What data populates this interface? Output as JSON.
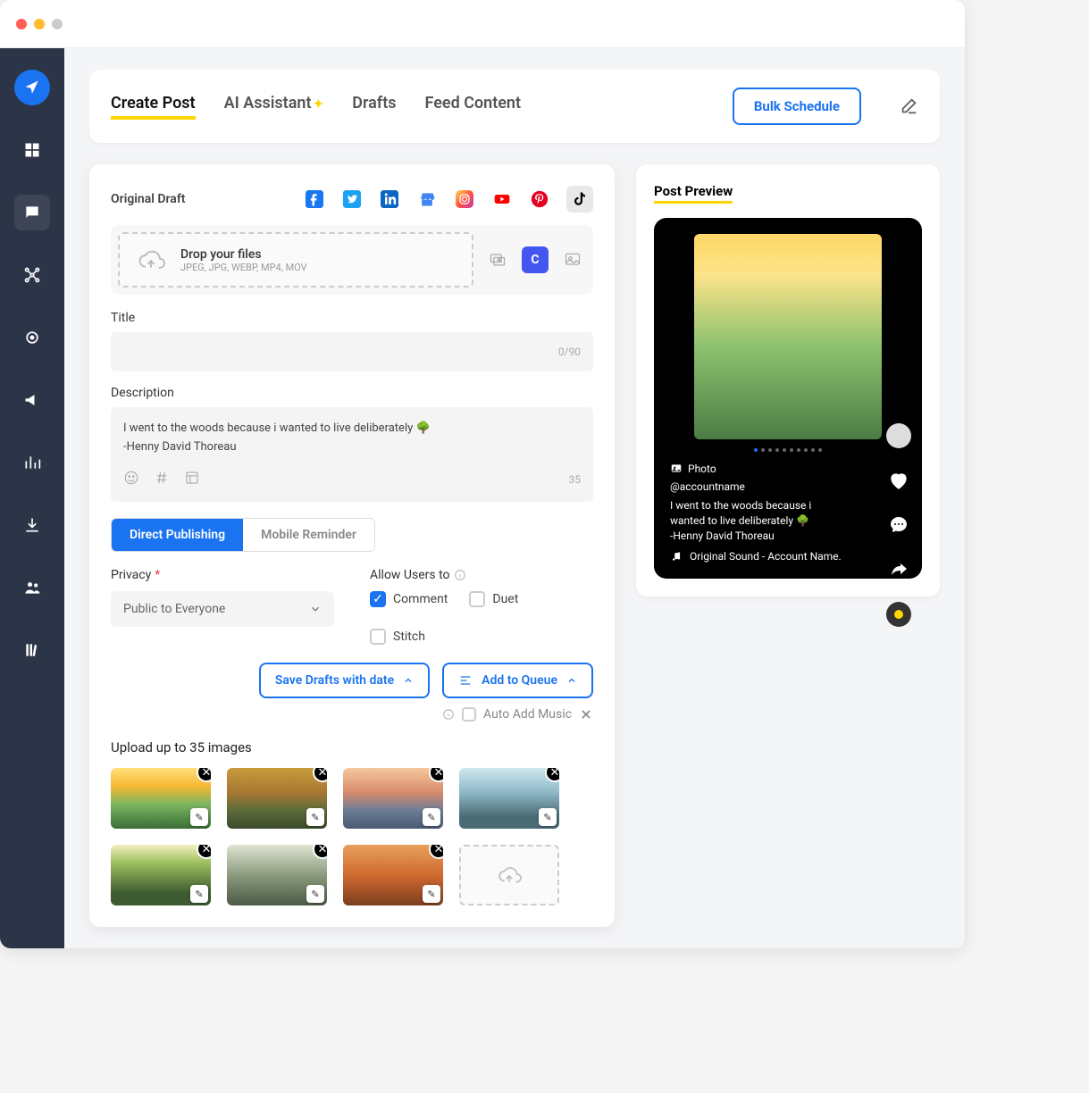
{
  "tabs": {
    "create": "Create Post",
    "ai": "AI Assistant",
    "drafts": "Drafts",
    "feed": "Feed Content"
  },
  "bulk_schedule": "Bulk Schedule",
  "editor": {
    "draft_label": "Original Draft",
    "drop_title": "Drop your files",
    "drop_sub": "JPEG, JPG, WEBP, MP4, MOV",
    "title_label": "Title",
    "title_counter": "0/90",
    "desc_label": "Description",
    "desc_text": "I went to the woods because i wanted to live deliberately 🌳\n-Henny David Thoreau",
    "desc_count": "35",
    "mode_direct": "Direct Publishing",
    "mode_mobile": "Mobile Reminder",
    "privacy_label": "Privacy",
    "privacy_value": "Public to Everyone",
    "allow_label": "Allow Users to",
    "chk_comment": "Comment",
    "chk_duet": "Duet",
    "chk_stitch": "Stitch",
    "save_btn": "Save Drafts with date",
    "queue_btn": "Add to Queue",
    "music_label": "Auto Add Music",
    "upload_label": "Upload up to 35 images"
  },
  "preview": {
    "title": "Post Preview",
    "type": "Photo",
    "handle": "@accountname",
    "desc": "I went to the woods because i wanted to live deliberately 🌳\n-Henny David Thoreau",
    "sound": "Original Sound - Account Name."
  }
}
